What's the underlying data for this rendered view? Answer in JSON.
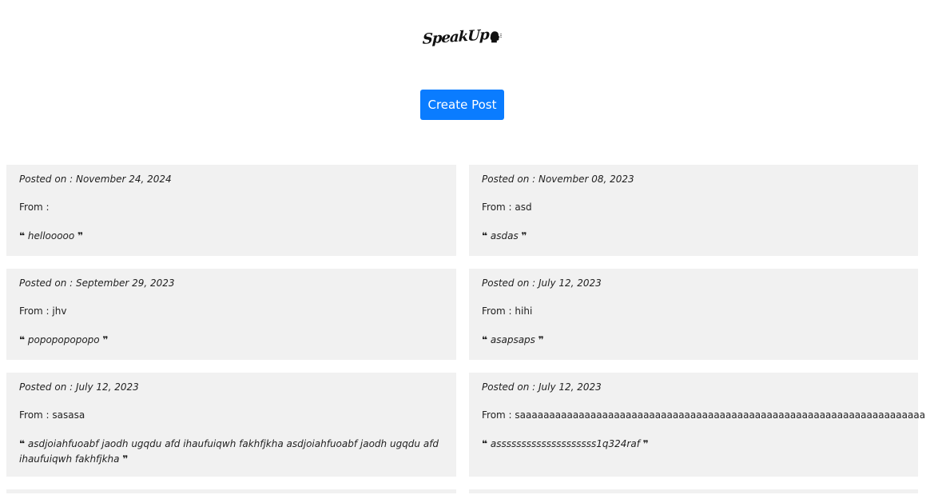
{
  "brand": {
    "logo_text": "SpeakUp"
  },
  "actions": {
    "create_post_label": "Create Post"
  },
  "labels": {
    "posted_prefix": "Posted on : ",
    "from_prefix": "From : ",
    "quote_open": "❝",
    "quote_close": "❞"
  },
  "posts": [
    {
      "date": "November 24, 2024",
      "from": "",
      "message": "hellooooo"
    },
    {
      "date": "November 08, 2023",
      "from": "asd",
      "message": "asdas"
    },
    {
      "date": "September 29, 2023",
      "from": "jhv",
      "message": "popopopopopo"
    },
    {
      "date": "July 12, 2023",
      "from": "hihi",
      "message": "asapsaps"
    },
    {
      "date": "July 12, 2023",
      "from": "sasasa",
      "message": "asdjoiahfuoabf jaodh ugqdu afd ihaufuiqwh fakhfjkha asdjoiahfuoabf jaodh ugqdu afd ihaufuiqwh fakhfjkha"
    },
    {
      "date": "July 12, 2023",
      "from": "saaaaaaaaaaaaaaaaaaaaaaaaaaaaaaaaaaaaaaaaaaaaaaaaaaaaaaaaaaaaaaaaaaaaa",
      "message": "assssssssssssssssssss1q324raf"
    }
  ]
}
